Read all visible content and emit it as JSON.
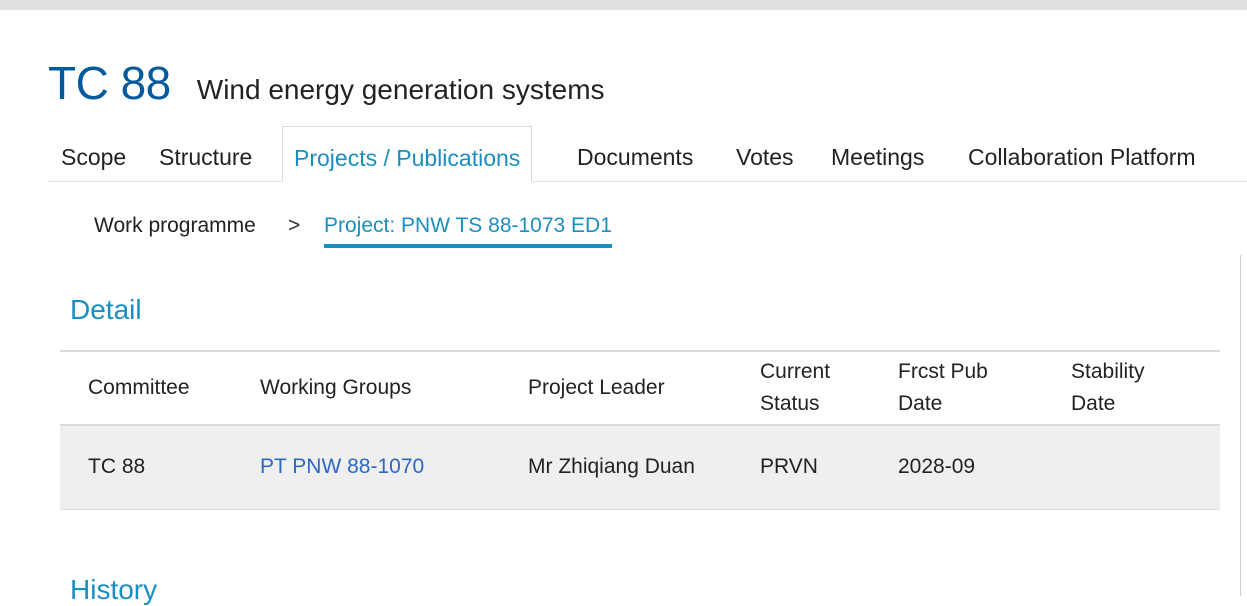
{
  "committee": {
    "code": "TC 88",
    "title": "Wind energy generation systems"
  },
  "tabs": [
    {
      "label": "Scope",
      "active": false
    },
    {
      "label": "Structure",
      "active": false
    },
    {
      "label": "Projects / Publications",
      "active": true
    },
    {
      "label": "Documents",
      "active": false
    },
    {
      "label": "Votes",
      "active": false
    },
    {
      "label": "Meetings",
      "active": false
    },
    {
      "label": "Collaboration Platform",
      "active": false
    }
  ],
  "breadcrumb": {
    "parent": "Work programme",
    "separator": ">",
    "current": "Project: PNW TS 88-1073 ED1"
  },
  "detail": {
    "heading": "Detail",
    "columns": [
      "Committee",
      "Working Groups",
      "Project Leader",
      "Current Status",
      "Frcst Pub Date",
      "Stability Date"
    ],
    "column_lines": [
      [
        "Committee"
      ],
      [
        "Working Groups"
      ],
      [
        "Project Leader"
      ],
      [
        "Current",
        "Status"
      ],
      [
        "Frcst Pub",
        "Date"
      ],
      [
        "Stability",
        "Date"
      ]
    ],
    "row": {
      "committee": "TC 88",
      "working_groups": "PT PNW 88-1070",
      "project_leader": "Mr Zhiqiang Duan",
      "current_status": "PRVN",
      "frcst_pub_date": "2028-09",
      "stability_date": ""
    }
  },
  "history": {
    "heading": "History"
  },
  "colors": {
    "accent": "#1a8fbf",
    "committee_code": "#005a9c",
    "link": "#2c68c4",
    "row_background": "#efefef"
  }
}
